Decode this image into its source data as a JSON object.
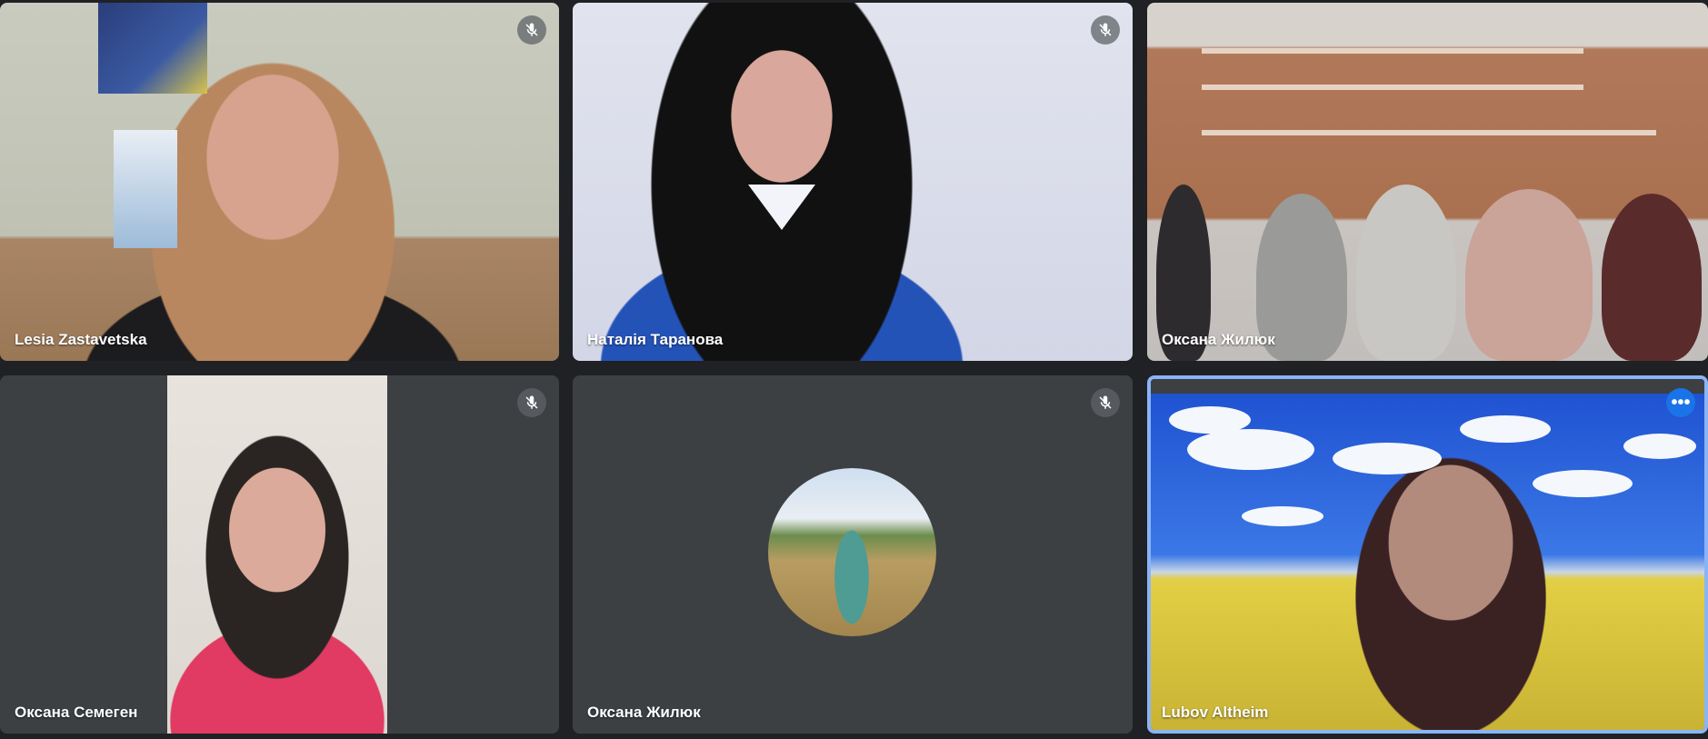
{
  "participants": [
    {
      "name": "Lesia Zastavetska",
      "muted": true
    },
    {
      "name": "Наталія Таранова",
      "muted": true
    },
    {
      "name": "Оксана Жилюк",
      "muted": false
    },
    {
      "name": "Оксана Семеген",
      "muted": true
    },
    {
      "name": "Оксана Жилюк",
      "muted": true,
      "avatar": true
    },
    {
      "name": "Lubov Altheim",
      "muted": false,
      "active_speaker": true
    }
  ],
  "icons": {
    "mute": "mic-off-icon",
    "more": "more-options-icon"
  },
  "colors": {
    "background": "#202124",
    "tile": "#3c4043",
    "active_border": "#8ab4f8",
    "more_button": "#1a73e8"
  },
  "more_glyph": "•••"
}
